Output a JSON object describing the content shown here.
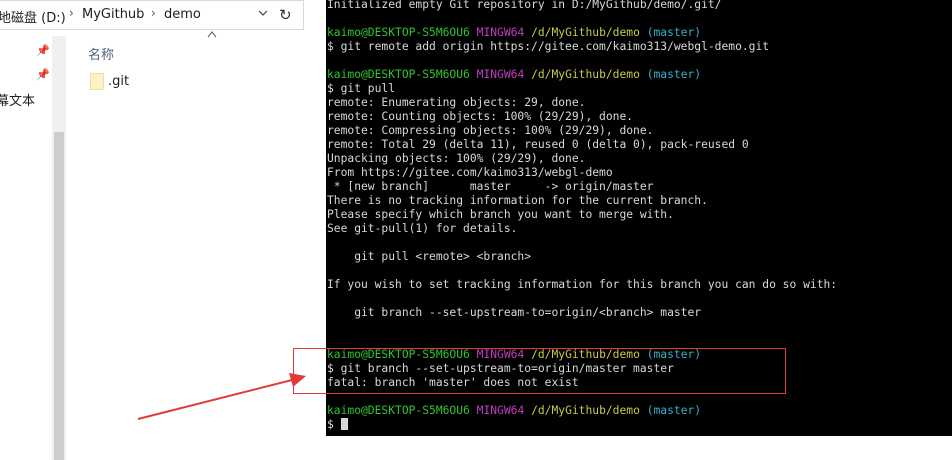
{
  "explorer": {
    "breadcrumbs": [
      "地磁盘 (D:)",
      "MyGithub",
      "demo"
    ],
    "column_header": "名称",
    "files": [
      ".git"
    ],
    "nav_label": "幕文本"
  },
  "terminal": {
    "lines": [
      {
        "text": "Initialized empty Git repository in D:/MyGithub/demo/.git/"
      },
      {
        "text": ""
      },
      {
        "prompt": {
          "user": "kaimo@DESKTOP-S5M6OU6",
          "shell": "MINGW64",
          "path": "/d/MyGithub/demo",
          "branch": "(master)"
        }
      },
      {
        "text": "$ git remote add origin https://gitee.com/kaimo313/webgl-demo.git"
      },
      {
        "text": ""
      },
      {
        "prompt": {
          "user": "kaimo@DESKTOP-S5M6OU6",
          "shell": "MINGW64",
          "path": "/d/MyGithub/demo",
          "branch": "(master)"
        }
      },
      {
        "text": "$ git pull"
      },
      {
        "text": "remote: Enumerating objects: 29, done."
      },
      {
        "text": "remote: Counting objects: 100% (29/29), done."
      },
      {
        "text": "remote: Compressing objects: 100% (29/29), done."
      },
      {
        "text": "remote: Total 29 (delta 11), reused 0 (delta 0), pack-reused 0"
      },
      {
        "text": "Unpacking objects: 100% (29/29), done."
      },
      {
        "text": "From https://gitee.com/kaimo313/webgl-demo"
      },
      {
        "text": " * [new branch]      master     -> origin/master"
      },
      {
        "text": "There is no tracking information for the current branch."
      },
      {
        "text": "Please specify which branch you want to merge with."
      },
      {
        "text": "See git-pull(1) for details."
      },
      {
        "text": ""
      },
      {
        "text": "    git pull <remote> <branch>"
      },
      {
        "text": ""
      },
      {
        "text": "If you wish to set tracking information for this branch you can do so with:"
      },
      {
        "text": ""
      },
      {
        "text": "    git branch --set-upstream-to=origin/<branch> master"
      },
      {
        "text": ""
      },
      {
        "text": ""
      },
      {
        "prompt": {
          "user": "kaimo@DESKTOP-S5M6OU6",
          "shell": "MINGW64",
          "path": "/d/MyGithub/demo",
          "branch": "(master)"
        }
      },
      {
        "text": "$ git branch --set-upstream-to=origin/master master"
      },
      {
        "text": "fatal: branch 'master' does not exist"
      },
      {
        "text": ""
      },
      {
        "prompt": {
          "user": "kaimo@DESKTOP-S5M6OU6",
          "shell": "MINGW64",
          "path": "/d/MyGithub/demo",
          "branch": "(master)"
        }
      },
      {
        "text": "$ ",
        "cursor": true
      }
    ]
  },
  "annotation": {
    "box_color": "#e03a3a",
    "arrow_color": "#e03a3a"
  },
  "colors": {
    "terminal_bg": "#000000",
    "prompt_user": "#2ec52e",
    "prompt_shell": "#c23bc2",
    "prompt_path": "#c8c84a",
    "prompt_branch": "#2fb3c8"
  }
}
